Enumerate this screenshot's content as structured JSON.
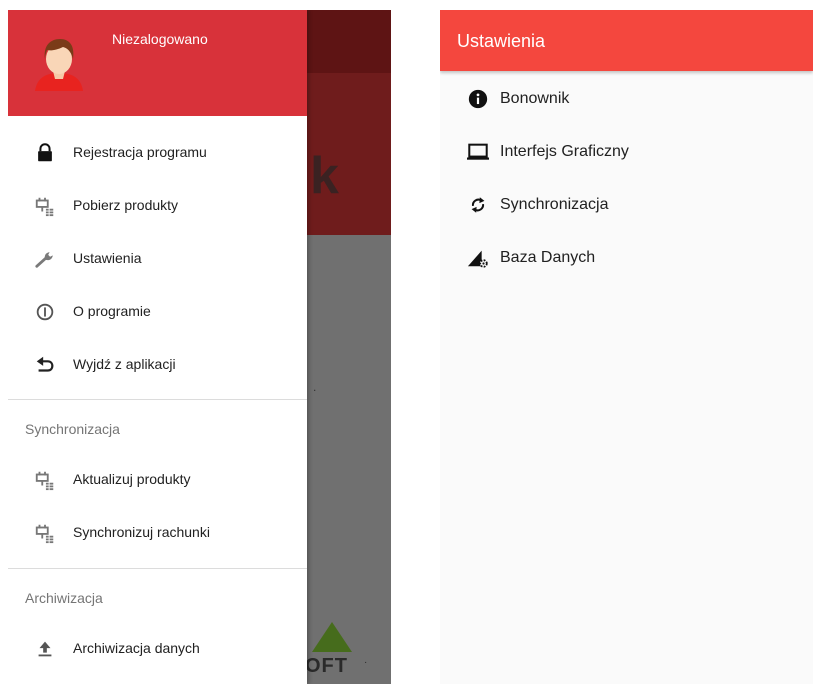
{
  "colors": {
    "drawer_header": "#d8323a",
    "settings_bar": "#f4473e",
    "scrim_appbar": "#5e1414",
    "scrim_hero": "#6f1c1c",
    "scrim_body": "#707070"
  },
  "left_screen": {
    "background": {
      "hero_letter": "k",
      "logo_text": "OFT",
      "logo_mark": "·"
    },
    "drawer": {
      "user_label": "Niezalogowano",
      "avatar_icon": "user-avatar-icon",
      "items": [
        {
          "label": "Rejestracja programu",
          "icon": "lock-icon"
        },
        {
          "label": "Pobierz produkty",
          "icon": "plug-list-icon"
        },
        {
          "label": "Ustawienia",
          "icon": "wrench-icon"
        },
        {
          "label": "O programie",
          "icon": "info-outline-icon"
        },
        {
          "label": "Wyjdź z aplikacji",
          "icon": "undo-icon"
        }
      ],
      "sections": [
        {
          "title": "Synchronizacja",
          "items": [
            {
              "label": "Aktualizuj produkty",
              "icon": "plug-list-icon"
            },
            {
              "label": "Synchronizuj rachunki",
              "icon": "plug-list-icon"
            }
          ]
        },
        {
          "title": "Archiwizacja",
          "items": [
            {
              "label": "Archiwizacja danych",
              "icon": "upload-icon"
            }
          ]
        }
      ]
    }
  },
  "right_screen": {
    "title": "Ustawienia",
    "items": [
      {
        "label": "Bonownik",
        "icon": "info-filled-icon"
      },
      {
        "label": "Interfejs Graficzny",
        "icon": "laptop-icon"
      },
      {
        "label": "Synchronizacja",
        "icon": "sync-icon"
      },
      {
        "label": "Baza Danych",
        "icon": "signal-settings-icon"
      }
    ]
  }
}
